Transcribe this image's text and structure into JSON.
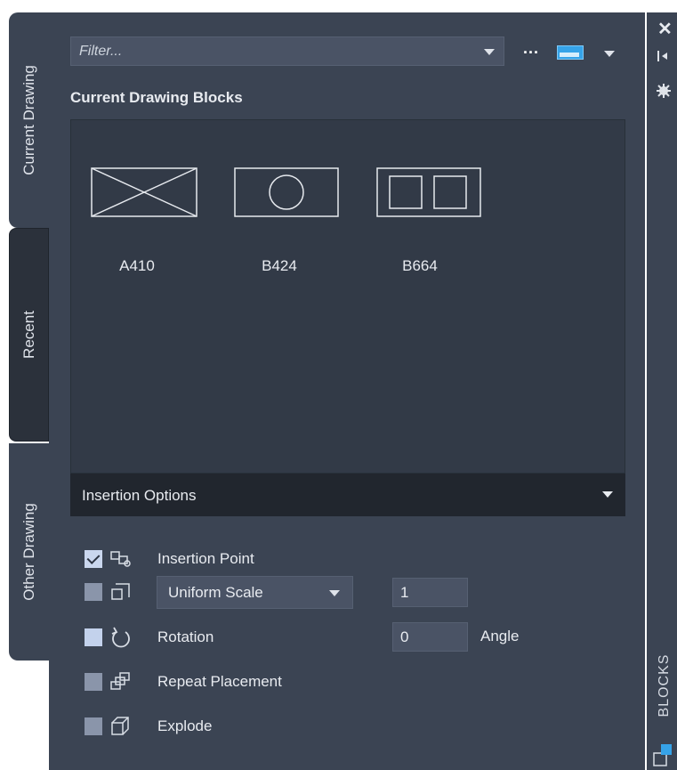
{
  "tabs": [
    {
      "label": "Current Drawing",
      "active": true
    },
    {
      "label": "Recent",
      "active": false
    },
    {
      "label": "Other Drawing",
      "active": false
    }
  ],
  "toolbar": {
    "filter_placeholder": "Filter...",
    "more_label": "..."
  },
  "section_title": "Current Drawing Blocks",
  "blocks": [
    {
      "name": "A410",
      "icon": "rectangle-with-cross-icon"
    },
    {
      "name": "B424",
      "icon": "rectangle-with-circle-icon"
    },
    {
      "name": "B664",
      "icon": "rectangle-with-two-squares-icon"
    }
  ],
  "insertion_options": {
    "header": "Insertion Options",
    "insertion_point": {
      "label": "Insertion Point",
      "checked": true
    },
    "scale": {
      "mode": "Uniform Scale",
      "value": "1",
      "checked": false
    },
    "rotation": {
      "label": "Rotation",
      "value": "0",
      "unit": "Angle",
      "checked": false
    },
    "repeat_placement": {
      "label": "Repeat Placement",
      "checked": false
    },
    "explode": {
      "label": "Explode",
      "checked": false
    }
  },
  "palette": {
    "title": "BLOCKS"
  },
  "colors": {
    "panel_bg": "#3b4453",
    "blocks_bg": "#323a47",
    "header_bg": "#21262e",
    "accent": "#36a3e8"
  }
}
